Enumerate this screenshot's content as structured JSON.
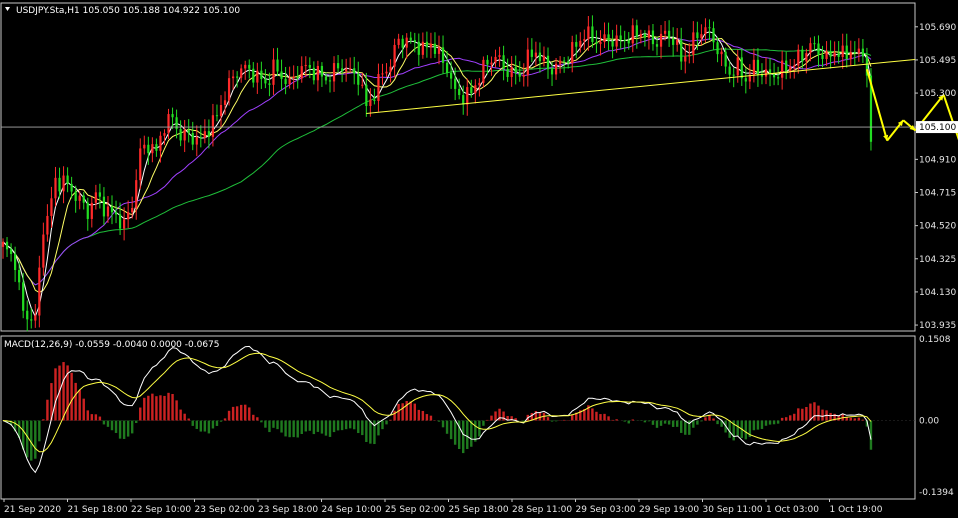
{
  "header": {
    "symbol_line": "USDJPY.Sta,H1  105.050 105.188 104.922 105.100",
    "triangle_icon": "triangle-down-icon"
  },
  "macd_header": "MACD(12,26,9) -0.0559 -0.0040 0.0000 -0.0675",
  "colors": {
    "background": "#000000",
    "frame": "#c8c8c8",
    "bull_candle": "#ff2a2a",
    "bear_candle": "#22dd22",
    "ma_fast": "#ffffff",
    "ma_mid": "#ffff66",
    "ma_purple": "#a040ff",
    "ma_slow": "#1fbf3a",
    "trendline": "#ffff44",
    "forecast_arrow": "#ffff00",
    "hist_pos": "#cc2222",
    "hist_neg": "#1f7a1f"
  },
  "price_axis": {
    "labels": [
      "105.690",
      "105.495",
      "105.300",
      "105.100",
      "104.910",
      "104.715",
      "104.520",
      "104.325",
      "104.130",
      "103.935"
    ],
    "current_price": "105.100"
  },
  "macd_axis": {
    "labels": [
      "0.1508",
      "0.00",
      "-0.1394"
    ]
  },
  "time_axis": {
    "labels": [
      "21 Sep 2020",
      "21 Sep 18:00",
      "22 Sep 10:00",
      "23 Sep 02:00",
      "23 Sep 18:00",
      "24 Sep 10:00",
      "25 Sep 02:00",
      "25 Sep 18:00",
      "28 Sep 11:00",
      "29 Sep 03:00",
      "29 Sep 19:00",
      "30 Sep 11:00",
      "1 Oct 03:00",
      "1 Oct 19:00"
    ]
  },
  "chart_data": {
    "type": "candlestick",
    "symbol": "USDJPY.Sta",
    "timeframe": "H1",
    "price_range": [
      103.9,
      105.83
    ],
    "macd_range": [
      -0.1394,
      0.1508
    ],
    "horizontal_level": 105.1,
    "trendline": {
      "from": {
        "bar": 90,
        "price": 105.18
      },
      "to": {
        "bar": 214,
        "price": 105.47
      }
    },
    "forecast_path": [
      {
        "bar": 214,
        "price": 105.44
      },
      {
        "bar": 219,
        "price": 105.02
      },
      {
        "bar": 223,
        "price": 105.14
      },
      {
        "bar": 226,
        "price": 105.08
      },
      {
        "bar": 233,
        "price": 105.29
      },
      {
        "bar": 242,
        "price": 104.66
      }
    ],
    "waypoints": [
      [
        0,
        104.4
      ],
      [
        3,
        104.31
      ],
      [
        5,
        104.0
      ],
      [
        8,
        103.97
      ],
      [
        10,
        104.52
      ],
      [
        11,
        104.56
      ],
      [
        13,
        104.78
      ],
      [
        15,
        104.78
      ],
      [
        18,
        104.7
      ],
      [
        21,
        104.6
      ],
      [
        23,
        104.7
      ],
      [
        26,
        104.6
      ],
      [
        28,
        104.58
      ],
      [
        30,
        104.52
      ],
      [
        32,
        104.65
      ],
      [
        34,
        104.95
      ],
      [
        36,
        105.0
      ],
      [
        38,
        104.95
      ],
      [
        40,
        105.12
      ],
      [
        42,
        105.15
      ],
      [
        44,
        105.05
      ],
      [
        46,
        105.05
      ],
      [
        49,
        105.02
      ],
      [
        51,
        105.1
      ],
      [
        53,
        105.16
      ],
      [
        55,
        105.3
      ],
      [
        57,
        105.39
      ],
      [
        59,
        105.45
      ],
      [
        61,
        105.43
      ],
      [
        63,
        105.4
      ],
      [
        65,
        105.35
      ],
      [
        67,
        105.45
      ],
      [
        69,
        105.4
      ],
      [
        71,
        105.35
      ],
      [
        73,
        105.43
      ],
      [
        75,
        105.45
      ],
      [
        77,
        105.43
      ],
      [
        80,
        105.38
      ],
      [
        82,
        105.43
      ],
      [
        84,
        105.46
      ],
      [
        86,
        105.42
      ],
      [
        88,
        105.4
      ],
      [
        90,
        105.22
      ],
      [
        92,
        105.3
      ],
      [
        94,
        105.42
      ],
      [
        96,
        105.47
      ],
      [
        98,
        105.62
      ],
      [
        100,
        105.6
      ],
      [
        102,
        105.6
      ],
      [
        104,
        105.55
      ],
      [
        106,
        105.6
      ],
      [
        108,
        105.52
      ],
      [
        110,
        105.45
      ],
      [
        112,
        105.3
      ],
      [
        114,
        105.28
      ],
      [
        116,
        105.3
      ],
      [
        118,
        105.4
      ],
      [
        120,
        105.48
      ],
      [
        122,
        105.52
      ],
      [
        124,
        105.45
      ],
      [
        126,
        105.42
      ],
      [
        128,
        105.4
      ],
      [
        130,
        105.5
      ],
      [
        132,
        105.55
      ],
      [
        134,
        105.47
      ],
      [
        136,
        105.44
      ],
      [
        138,
        105.47
      ],
      [
        140,
        105.52
      ],
      [
        142,
        105.58
      ],
      [
        144,
        105.65
      ],
      [
        146,
        105.62
      ],
      [
        148,
        105.6
      ],
      [
        150,
        105.62
      ],
      [
        152,
        105.6
      ],
      [
        154,
        105.62
      ],
      [
        156,
        105.64
      ],
      [
        158,
        105.66
      ],
      [
        160,
        105.62
      ],
      [
        162,
        105.6
      ],
      [
        164,
        105.65
      ],
      [
        166,
        105.62
      ],
      [
        168,
        105.5
      ],
      [
        170,
        105.55
      ],
      [
        172,
        105.65
      ],
      [
        174,
        105.68
      ],
      [
        176,
        105.62
      ],
      [
        178,
        105.5
      ],
      [
        180,
        105.42
      ],
      [
        182,
        105.45
      ],
      [
        184,
        105.38
      ],
      [
        186,
        105.45
      ],
      [
        188,
        105.42
      ],
      [
        190,
        105.4
      ],
      [
        192,
        105.42
      ],
      [
        194,
        105.45
      ],
      [
        196,
        105.48
      ],
      [
        198,
        105.52
      ],
      [
        200,
        105.58
      ],
      [
        202,
        105.55
      ],
      [
        204,
        105.5
      ],
      [
        206,
        105.55
      ],
      [
        208,
        105.52
      ],
      [
        210,
        105.55
      ],
      [
        212,
        105.52
      ],
      [
        213,
        105.55
      ],
      [
        214,
        105.42
      ],
      [
        215,
        104.98
      ],
      [
        216,
        105.1
      ]
    ]
  }
}
